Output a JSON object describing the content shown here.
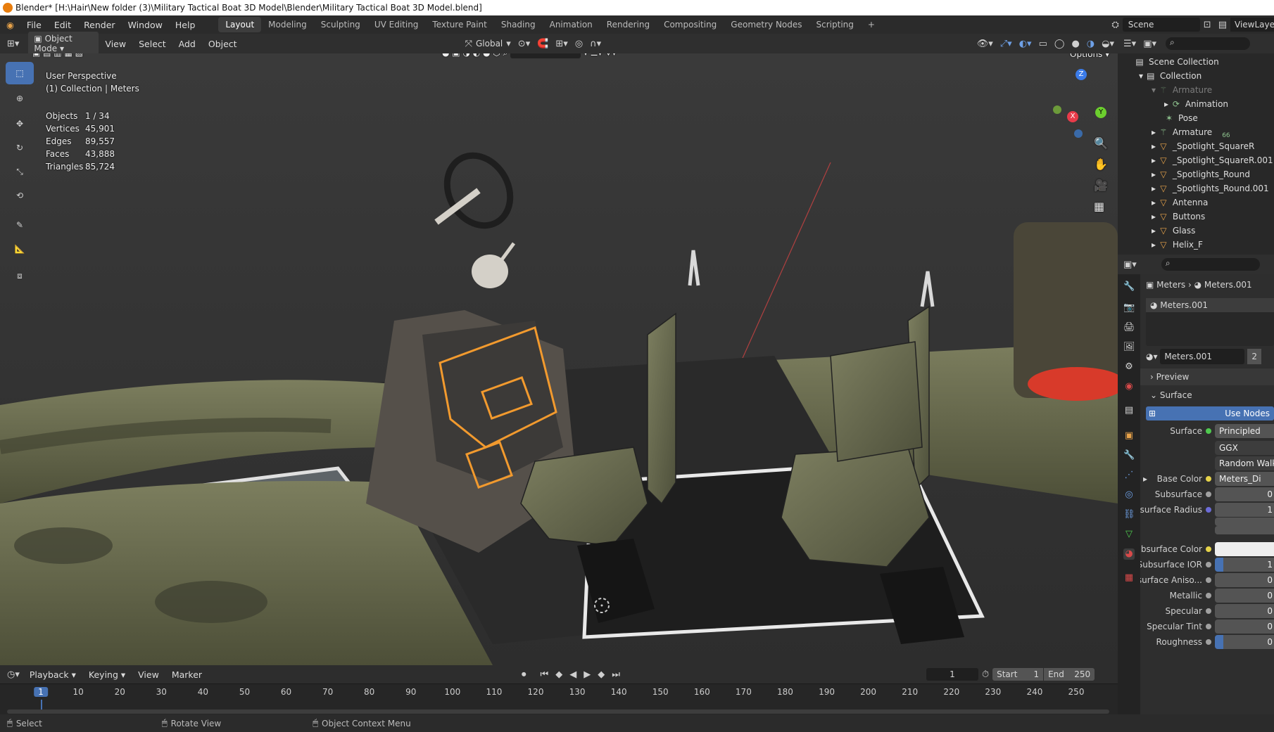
{
  "window": {
    "title": "Blender* [H:\\Hair\\New folder (3)\\Military Tactical Boat 3D Model\\Blender\\Military Tactical Boat 3D Model.blend]"
  },
  "menu": {
    "items": [
      "File",
      "Edit",
      "Render",
      "Window",
      "Help"
    ]
  },
  "workspaces": {
    "tabs": [
      "Layout",
      "Modeling",
      "Sculpting",
      "UV Editing",
      "Texture Paint",
      "Shading",
      "Animation",
      "Rendering",
      "Compositing",
      "Geometry Nodes",
      "Scripting"
    ],
    "active": "Layout",
    "add": "+"
  },
  "scene": {
    "name": "Scene",
    "view_layer": "ViewLayer"
  },
  "viewport_header": {
    "mode": "Object Mode",
    "menus": [
      "View",
      "Select",
      "Add",
      "Object"
    ],
    "orientation": "Global",
    "options": "Options"
  },
  "overlay": {
    "perspective": "User Perspective",
    "collection_line": "(1) Collection | Meters",
    "stats": [
      {
        "label": "Objects",
        "value": "1 / 34"
      },
      {
        "label": "Vertices",
        "value": "45,901"
      },
      {
        "label": "Edges",
        "value": "89,557"
      },
      {
        "label": "Faces",
        "value": "43,888"
      },
      {
        "label": "Triangles",
        "value": "85,724"
      }
    ]
  },
  "gizmo": {
    "x": "X",
    "y": "Y",
    "z": "Z"
  },
  "outliner": {
    "root": "Scene Collection",
    "collection": "Collection",
    "items": [
      {
        "name": "Armature",
        "icon": "armature-icon",
        "dim": true
      },
      {
        "name": "Animation",
        "icon": "action-icon"
      },
      {
        "name": "Pose",
        "icon": "pose-icon"
      },
      {
        "name": "Armature",
        "icon": "armature-icon",
        "badge": "66"
      },
      {
        "name": "_Spotlight_SquareR",
        "icon": "mesh-icon"
      },
      {
        "name": "_Spotlight_SquareR.001",
        "icon": "mesh-icon"
      },
      {
        "name": "_Spotlights_Round",
        "icon": "mesh-icon"
      },
      {
        "name": "_Spotlights_Round.001",
        "icon": "mesh-icon"
      },
      {
        "name": "Antenna",
        "icon": "mesh-icon"
      },
      {
        "name": "Buttons",
        "icon": "mesh-icon"
      },
      {
        "name": "Glass",
        "icon": "mesh-icon"
      },
      {
        "name": "Helix_F",
        "icon": "mesh-icon"
      }
    ]
  },
  "properties": {
    "breadcrumb": [
      "Meters",
      "Meters.001"
    ],
    "slot": "Meters.001",
    "material": "Meters.001",
    "users": "2",
    "panels": {
      "preview": "Preview",
      "surface": "Surface"
    },
    "use_nodes": "Use Nodes",
    "rows": [
      {
        "label": "Surface",
        "value": "Principled",
        "dot": "#4fc94f"
      },
      {
        "label": "",
        "value": "GGX"
      },
      {
        "label": "",
        "value": "Random Walk"
      },
      {
        "label": "Base Color",
        "value": "Meters_Di",
        "dot": "#e6d34a"
      },
      {
        "label": "Subsurface",
        "value": "0",
        "dot": "#a0a0a0"
      },
      {
        "label": "Subsurface Radius",
        "value": "1",
        "dot": "#6c6cd8"
      },
      {
        "label": "Subsurface Color",
        "value": "",
        "dot": "#e6d34a"
      },
      {
        "label": "Subsurface IOR",
        "value": "1",
        "dot": "#a0a0a0"
      },
      {
        "label": "Subsurface Aniso...",
        "value": "0",
        "dot": "#a0a0a0"
      },
      {
        "label": "Metallic",
        "value": "0",
        "dot": "#a0a0a0"
      },
      {
        "label": "Specular",
        "value": "0",
        "dot": "#a0a0a0"
      },
      {
        "label": "Specular Tint",
        "value": "0",
        "dot": "#a0a0a0"
      },
      {
        "label": "Roughness",
        "value": "0",
        "dot": "#a0a0a0"
      }
    ]
  },
  "timeline": {
    "menus": [
      "Playback",
      "Keying",
      "View",
      "Marker"
    ],
    "current_frame": "1",
    "start_label": "Start",
    "start": "1",
    "end_label": "End",
    "end": "250",
    "ticks": [
      "1",
      "10",
      "20",
      "30",
      "40",
      "50",
      "60",
      "70",
      "80",
      "90",
      "100",
      "110",
      "120",
      "130",
      "140",
      "150",
      "160",
      "170",
      "180",
      "190",
      "200",
      "210",
      "220",
      "230",
      "240",
      "250"
    ]
  },
  "status": {
    "items": [
      "Select",
      "Rotate View",
      "Object Context Menu"
    ]
  },
  "colors": {
    "accent": "#4772b3",
    "selection": "#f29a2e",
    "header": "#2f2f2f"
  }
}
